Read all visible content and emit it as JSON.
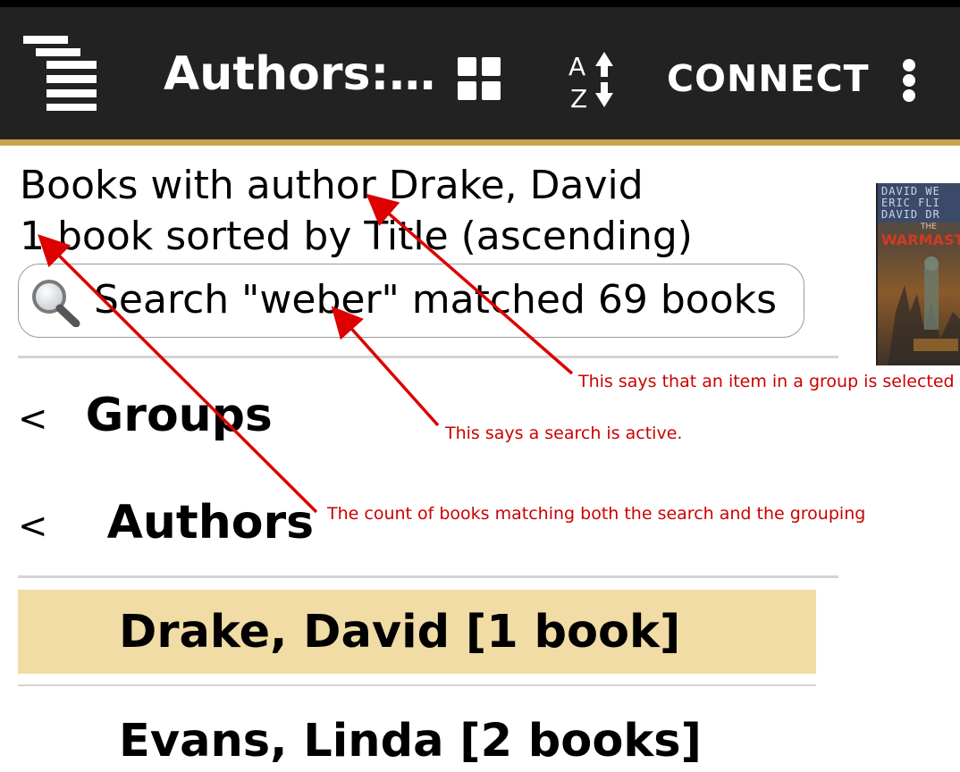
{
  "toolbar": {
    "title": "Authors:…",
    "connect_label": "CONNECT"
  },
  "icons": {
    "menu": "menu-icon",
    "grid": "grid-view-icon",
    "sort": "sort-az-icon",
    "overflow": "overflow-menu-icon",
    "search": "search-icon"
  },
  "sort_icon": {
    "top_letter": "A",
    "bottom_letter": "Z"
  },
  "header": {
    "line1": "Books with author Drake, David",
    "line2": "1 book sorted by Title (ascending)"
  },
  "cover": {
    "author_lines": [
      "DAVID WE",
      "ERIC FLI",
      "DAVID DR"
    ],
    "the": "THE",
    "title": "WARMAST"
  },
  "search": {
    "text": "Search \"weber\" matched 69 books"
  },
  "groups": {
    "label": "Groups",
    "chevron": "<"
  },
  "authors_group": {
    "label": "Authors",
    "chevron": "<"
  },
  "items": [
    {
      "label": "Drake, David [1 book]",
      "selected": true
    },
    {
      "label": "Evans, Linda [2 books]",
      "selected": false
    }
  ],
  "annotations": [
    "This says that an item in a group is selected",
    "This says a search is active.",
    "The count of books matching both the search and the grouping"
  ],
  "colors": {
    "toolbar_bg": "#222222",
    "toolbar_accent": "#c9a24c",
    "selected_bg": "#f2dca6",
    "annotation": "#cc0000"
  }
}
